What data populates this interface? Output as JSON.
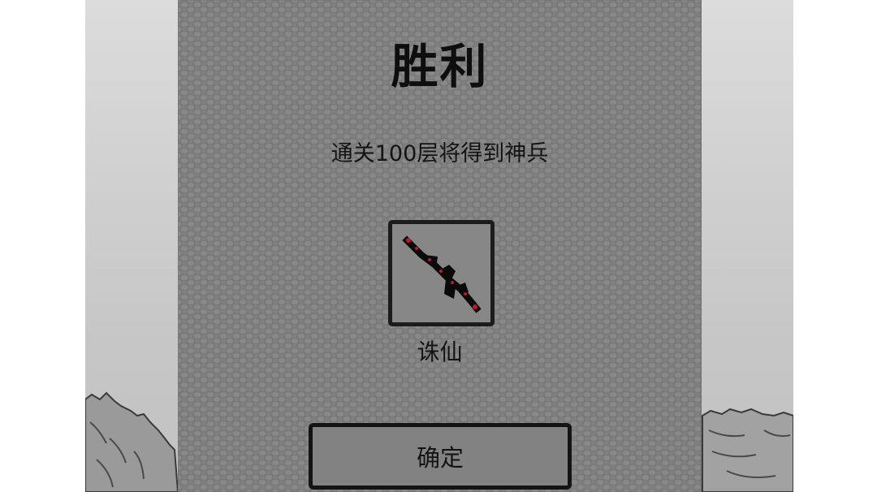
{
  "dialog": {
    "title": "胜利",
    "subtitle": "通关100层将得到神兵",
    "reward": {
      "icon": "sword-icon",
      "name": "诛仙"
    },
    "confirm_label": "确定"
  },
  "colors": {
    "dialog_background": "#808080",
    "border": "#141414",
    "sword_glow": "#c0182a"
  }
}
